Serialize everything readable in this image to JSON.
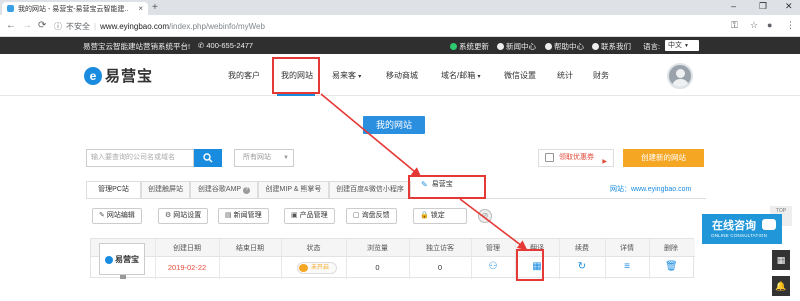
{
  "browser": {
    "tab_title": "我的网站 - 易营宝-易营宝云智能建...",
    "new_tab": "+",
    "url_info": "ⓘ",
    "insecure_label": "不安全",
    "url_host": "www.eyingbao.com",
    "url_path": "/index.php/webinfo/myWeb"
  },
  "topbar": {
    "slogan": "易营宝云智能建站营销系统平台!",
    "phone": "400-655-2477",
    "links": [
      "系统更新",
      "新闻中心",
      "帮助中心",
      "联系我们"
    ],
    "lang_label": "语言:",
    "lang_value": "中文"
  },
  "nav": {
    "logo_text": "易营宝",
    "logo_mark": "e",
    "items": [
      "我的客户",
      "我的网站",
      "易来客",
      "移动商城",
      "域名/邮箱",
      "微信设置",
      "统计",
      "财务"
    ],
    "active_index": 1
  },
  "callout": "我的网站",
  "search": {
    "placeholder": "输入要查询的公司名或域名",
    "filter_value": "所有网站"
  },
  "promo": {
    "label": "领取优惠券"
  },
  "create_button": "创建新的网站",
  "site_tabs": [
    "管理PC站",
    "创建触屏站",
    "创建谷歌AMP",
    "创建MIP & 熊掌号",
    "创建百度&微信小程序"
  ],
  "site_name": "易营宝",
  "website_label": "网站：www.eyingbao.com",
  "actions": [
    "网站编辑",
    "网站设置",
    "新闻管理",
    "产品管理",
    "询盘反馈",
    "锁定"
  ],
  "table": {
    "headers": [
      "创建日期",
      "结束日期",
      "状态",
      "浏览量",
      "独立访客",
      "管理",
      "翻译",
      "续费",
      "详情",
      "删除"
    ],
    "row": {
      "thumb_text": "易营宝",
      "create_date": "2019-02-22",
      "end_date": "",
      "status": "未开启",
      "views": "0",
      "visitors": "0"
    }
  },
  "consult": {
    "big": "在线咨询",
    "small": "ONLINE CONSULTATION"
  },
  "top_label": "TOP",
  "colors": {
    "accent": "#1a8ce0",
    "orange": "#f5a623",
    "red": "#e53935",
    "dark": "#2f2f2f"
  }
}
